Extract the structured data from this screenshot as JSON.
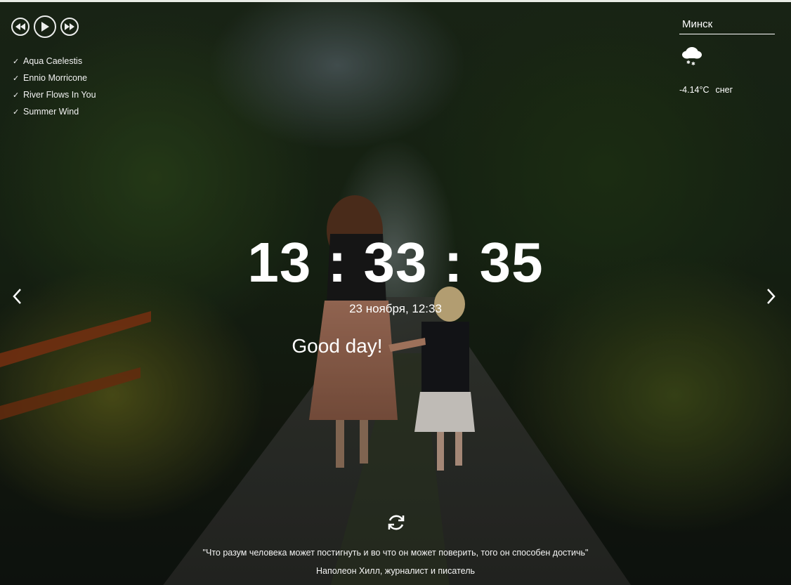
{
  "player": {
    "prev_icon": "rewind-icon",
    "play_icon": "play-icon",
    "next_icon": "fast-forward-icon"
  },
  "playlist": [
    {
      "title": "Aqua Caelestis",
      "checked": true
    },
    {
      "title": "Ennio Morricone",
      "checked": true
    },
    {
      "title": "River Flows In You",
      "checked": true
    },
    {
      "title": "Summer Wind",
      "checked": true
    }
  ],
  "weather": {
    "city": "Минск",
    "icon": "snow-cloud-icon",
    "temperature": "-4.14°C",
    "description": "снег"
  },
  "clock": {
    "time": "13 : 33 : 35",
    "date": "23 ноября, 12:33",
    "greeting": "Good day!"
  },
  "quote": {
    "text": "\"Что разум человека может постигнуть и во что он может поверить, того он способен достичь\"",
    "author": "Наполеон Хилл, журналист и писатель"
  },
  "colors": {
    "text": "#ffffff",
    "top_border": "#e9ece6"
  }
}
